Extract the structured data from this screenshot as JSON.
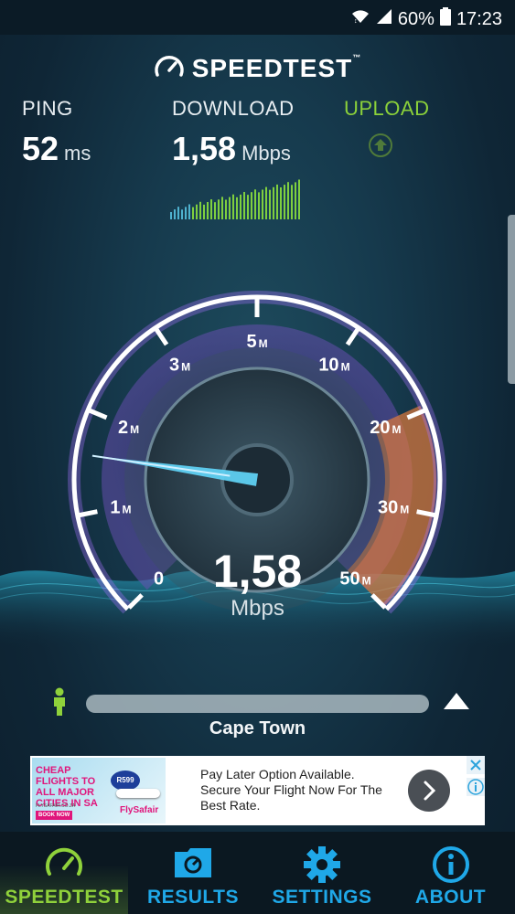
{
  "status_bar": {
    "battery_percent": "60%",
    "time": "17:23",
    "icons": [
      "wifi-icon",
      "signal-icon",
      "battery-icon"
    ]
  },
  "app": {
    "title": "SPEEDTEST",
    "trademark": "™"
  },
  "metrics": {
    "ping": {
      "label": "PING",
      "value": "52",
      "unit": "ms"
    },
    "download": {
      "label": "DOWNLOAD",
      "value": "1,58",
      "unit": "Mbps"
    },
    "upload": {
      "label": "UPLOAD",
      "icon": "upload-arrow-icon"
    }
  },
  "gauge": {
    "scale_labels": [
      {
        "num": "0",
        "unit": ""
      },
      {
        "num": "1",
        "unit": "M"
      },
      {
        "num": "2",
        "unit": "M"
      },
      {
        "num": "3",
        "unit": "M"
      },
      {
        "num": "5",
        "unit": "M"
      },
      {
        "num": "10",
        "unit": "M"
      },
      {
        "num": "20",
        "unit": "M"
      },
      {
        "num": "30",
        "unit": "M"
      },
      {
        "num": "50",
        "unit": "M"
      }
    ],
    "current_value": "1,58",
    "current_unit": "Mbps",
    "needle_value_mbps": 1.58,
    "colors": {
      "arc": "#a673ff",
      "high_zone": "#e07a3c",
      "needle": "#5fd0f2"
    }
  },
  "location": {
    "server_name": "Cape Town"
  },
  "ad": {
    "image_headline": "CHEAP FLIGHTS TO ALL MAJOR CITIES IN SA",
    "image_price": "R599",
    "image_brand": "FlySafair",
    "image_button": "BOOK NOW",
    "image_url_text": "FLYSAFAIR.CO.ZA",
    "text": "Pay Later Option Available. Secure Your Flight Now For The Best Rate.",
    "go_icon": "chevron-right-icon",
    "close_icon": "close-icon",
    "info_icon": "info-icon"
  },
  "nav": {
    "items": [
      {
        "label": "SPEEDTEST",
        "icon": "speedometer-icon",
        "active": true
      },
      {
        "label": "RESULTS",
        "icon": "folder-icon",
        "active": false
      },
      {
        "label": "SETTINGS",
        "icon": "gear-icon",
        "active": false
      },
      {
        "label": "ABOUT",
        "icon": "info-icon",
        "active": false
      }
    ],
    "accent": "#1fa8e8",
    "active_color": "#8fd13b"
  }
}
